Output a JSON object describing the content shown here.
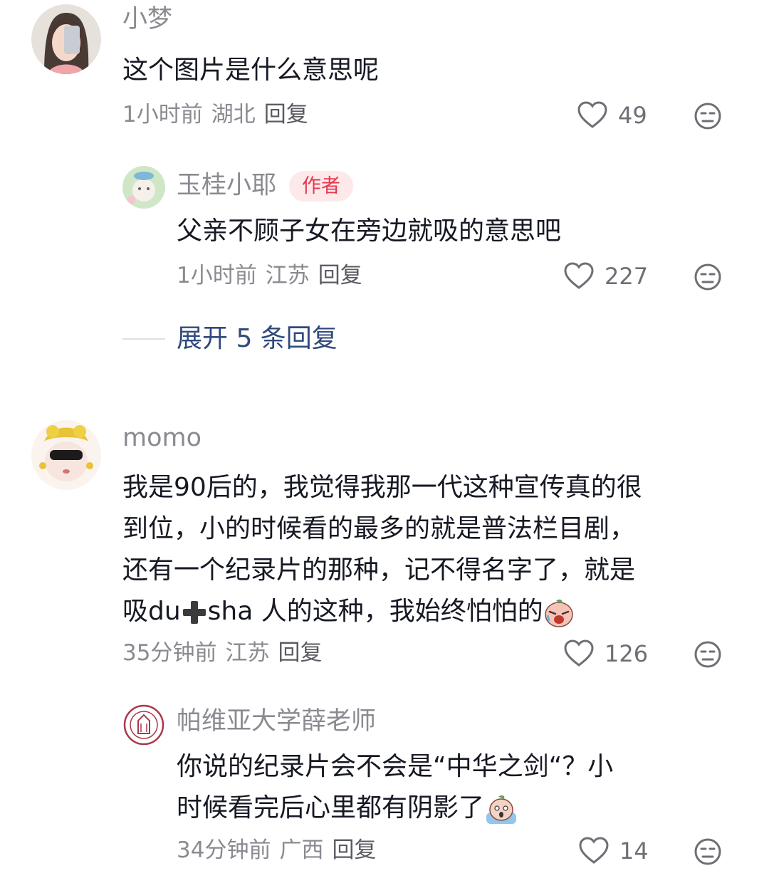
{
  "comments": [
    {
      "user": "小梦",
      "text": "这个图片是什么意思呢",
      "time": "1小时前",
      "location": "湖北",
      "reply_label": "回复",
      "likes": "49",
      "avatar_icon": "selfie-avatar",
      "replies": [
        {
          "user": "玉桂小耶",
          "badge": "作者",
          "text": "父亲不顾子女在旁边就吸的意思吧",
          "time": "1小时前",
          "location": "江苏",
          "reply_label": "回复",
          "likes": "227",
          "avatar_icon": "cartoon-avatar"
        }
      ],
      "expand_label": "展开 5 条回复"
    },
    {
      "user": "momo",
      "text_lines": [
        "我是90后的，我觉得我那一代这种宣传真的很",
        "到位，小的时候看的最多的就是普法栏目剧，",
        "还有一个纪录片的那种，记不得名字了，就是"
      ],
      "text_last_a": "吸du",
      "text_last_b": "sha 人的这种，我始终怕怕的",
      "time": "35分钟前",
      "location": "江苏",
      "reply_label": "回复",
      "likes": "126",
      "avatar_icon": "cartoon-sunglasses-avatar",
      "inline_icons": [
        "plus-emoji-icon",
        "crying-emoji-icon"
      ],
      "replies": [
        {
          "user": "帕维亚大学薛老师",
          "text_lines": [
            "你说的纪录片会不会是“中华之剑“？小",
            "时候看完后心里都有阴影了"
          ],
          "time": "34分钟前",
          "location": "广西",
          "reply_label": "回复",
          "likes": "14",
          "avatar_icon": "university-seal-avatar",
          "inline_icons": [
            "scared-emoji-icon"
          ]
        }
      ]
    }
  ],
  "colors": {
    "author_badge_bg": "#fde8ea",
    "author_badge_text": "#e5384d",
    "expand_link": "#2f4a7c"
  }
}
